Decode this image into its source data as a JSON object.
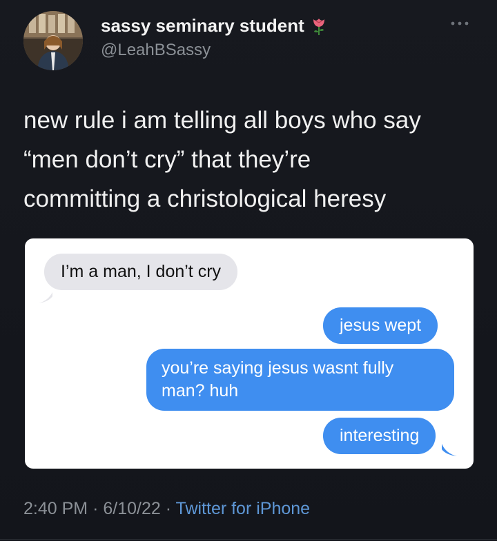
{
  "author": {
    "display_name": "sassy seminary student",
    "handle": "@LeahBSassy",
    "name_emoji": "rose-icon"
  },
  "tweet": {
    "text": "new rule i am telling all boys who say\n“men don’t cry” that they’re\ncommitting a christological heresy"
  },
  "screenshot": {
    "received": [
      "I’m a man, I don’t cry"
    ],
    "sent": [
      "jesus wept",
      "you’re saying jesus wasnt fully man? huh",
      "interesting"
    ]
  },
  "meta": {
    "time": "2:40 PM",
    "date": "6/10/22",
    "separator": "·",
    "source": "Twitter for iPhone"
  },
  "colors": {
    "background": "#15171e",
    "sent_bubble": "#3f8ef0",
    "received_bubble": "#e5e5ea",
    "link": "#5e97d6"
  }
}
